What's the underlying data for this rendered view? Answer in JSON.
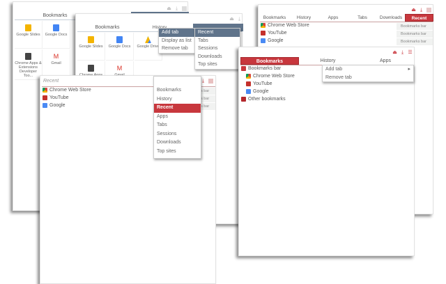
{
  "colors": {
    "accent_red": "#c8373d",
    "slate": "#60748b"
  },
  "window_apps_1": {
    "tab_bookmarks": "Bookmarks",
    "tiles": [
      {
        "label": "Google Slides",
        "icon": "slides-icon"
      },
      {
        "label": "Google Docs",
        "icon": "docs-icon"
      },
      {
        "label": "Chrome Apps & Extensions Developer Too...",
        "icon": "chrome-apps-icon"
      },
      {
        "label": "Gmail",
        "icon": "gmail-icon"
      }
    ]
  },
  "window_apps_2": {
    "tab_bookmarks": "Bookmarks",
    "tab_history": "History",
    "tiles": [
      {
        "label": "Google Slides"
      },
      {
        "label": "Google Docs"
      },
      {
        "label": "Google Drive"
      },
      {
        "label": "Chrome Apps"
      },
      {
        "label": "Gmail"
      }
    ],
    "context_menu": [
      "Add tab",
      "Display as list",
      "Remove tab"
    ],
    "submenu": [
      "Recent",
      "Tabs",
      "Sessions",
      "Downloads",
      "Top sites"
    ]
  },
  "window_recent_tabs": {
    "tabs": [
      "Bookmarks",
      "History",
      "Apps",
      "Tabs",
      "Downloads",
      "Recent"
    ],
    "rows": [
      {
        "title": "Chrome Web Store",
        "folder": "Bookmarks bar"
      },
      {
        "title": "YouTube",
        "folder": "Bookmarks bar"
      },
      {
        "title": "Google",
        "folder": "Bookmarks bar"
      }
    ]
  },
  "window_bookmarks": {
    "tabs": [
      "Bookmarks",
      "History",
      "Apps"
    ],
    "tree": {
      "root": "Bookmarks bar",
      "children": [
        "Chrome Web Store",
        "YouTube",
        "Google"
      ],
      "other": "Other bookmarks"
    },
    "context_menu": [
      "Add tab",
      "Remove tab"
    ],
    "submenu_arrow": "▸"
  },
  "window_recent_dropdown": {
    "header": "Recent",
    "rows": [
      "Chrome Web Store",
      "YouTube",
      "Google"
    ],
    "partial_folder": "s bar",
    "menu": [
      "Bookmarks",
      "History",
      "Recent",
      "Apps",
      "Tabs",
      "Sessions",
      "Downloads",
      "Top sites"
    ]
  }
}
